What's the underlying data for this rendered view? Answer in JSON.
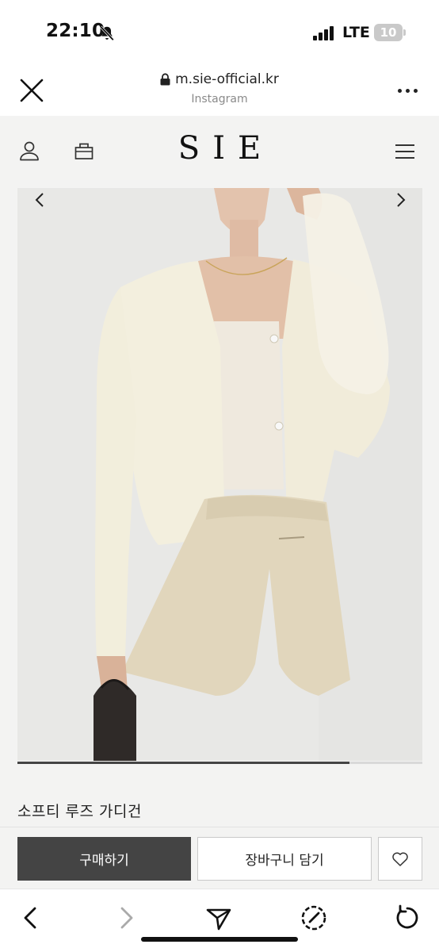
{
  "status_bar": {
    "time": "22:10",
    "network": "LTE",
    "battery": "10"
  },
  "browser": {
    "url": "m.sie-official.kr",
    "source": "Instagram"
  },
  "site": {
    "logo": "SIE",
    "product": {
      "name": "소프티 루즈 가디건",
      "image_position": 0.82
    },
    "actions": {
      "buy_label": "구매하기",
      "cart_label": "장바구니 담기"
    }
  },
  "colors": {
    "buy_button": "#444444",
    "page_background": "#f3f3f2"
  },
  "icons": [
    "bell-slash-icon",
    "lock-icon",
    "close-icon",
    "more-icon",
    "user-icon",
    "shopping-bag-icon",
    "hamburger-menu-icon",
    "chevron-left-icon",
    "chevron-right-icon",
    "heart-icon",
    "back-icon",
    "forward-icon",
    "share-icon",
    "safari-compass-icon",
    "reload-icon"
  ]
}
